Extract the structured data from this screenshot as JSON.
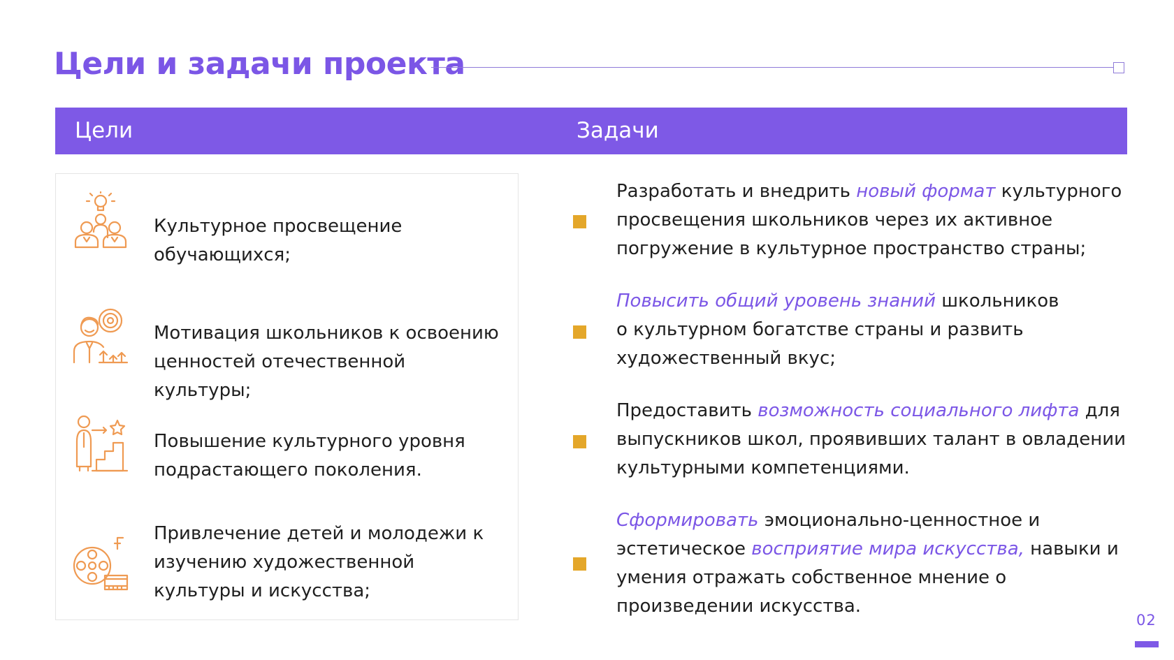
{
  "title": "Цели и задачи проекта",
  "header": {
    "goals_label": "Цели",
    "tasks_label": "Задачи"
  },
  "goals": [
    {
      "icon": "lightbulb-people-icon",
      "line1": "Культурное просвещение",
      "line2": "обучающихся;"
    },
    {
      "icon": "person-target-growth-icon",
      "line1": "Мотивация школьников к освоению",
      "line2": "ценностей отечественной культуры;"
    },
    {
      "icon": "person-steps-star-icon",
      "line1": "Повышение культурного уровня",
      "line2": "подрастающего поколения."
    },
    {
      "icon": "film-reel-music-icon",
      "line1": "Привлечение детей и молодежи к",
      "line2": "изучению художественной",
      "line3": "культуры и искусства;"
    }
  ],
  "tasks": [
    {
      "l1_a": "Разработать и внедрить ",
      "l1_hl": "новый формат",
      "l1_b": " культурного",
      "l2": "просвещения школьников через их активное",
      "l3": "погружение в культурное пространство страны;"
    },
    {
      "l1_hl": "Повысить общий уровень знаний",
      "l1_b": " школьников",
      "l2": "о культурном богатстве страны и развить",
      "l3": "художественный вкус;"
    },
    {
      "l1_a": "Предоставить ",
      "l1_hl": "возможность социального лифта",
      "l1_b": " для",
      "l2": "выпускников школ, проявивших талант в овладении",
      "l3": "культурными компетенциями."
    },
    {
      "l1_hl": "Сформировать",
      "l1_b": " эмоционально-ценностное и",
      "l2_a": "эстетическое ",
      "l2_hl": "восприятие мира искусства,",
      "l2_b": " навыки и",
      "l3": "умения отражать собственное мнение о",
      "l4": "произведении искусства."
    }
  ],
  "page_number": "02",
  "colors": {
    "accent": "#7e59e6",
    "bullet": "#e4a72a",
    "icon": "#ef9a52"
  }
}
